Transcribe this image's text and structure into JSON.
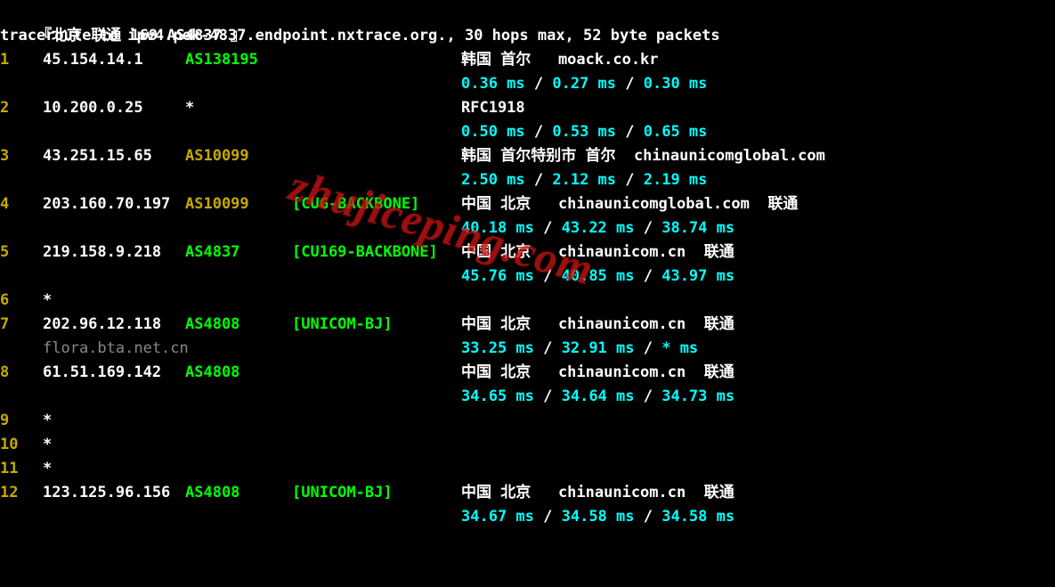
{
  "header": {
    "prefix": "『北京 联通 ",
    "asn_text": "169 AS4837",
    "suffix": " 』"
  },
  "trace_line": "traceroute to ipv4.pek-4837.endpoint.nxtrace.org., 30 hops max, 52 byte packets",
  "watermark": "zhujiceping.com",
  "hops": [
    {
      "n": "1",
      "ip": "45.154.14.1",
      "asn": "AS138195",
      "asn_color": "green",
      "net": "",
      "loc": "韩国 首尔   moack.co.kr",
      "lat": [
        "0.36 ms",
        "0.27 ms",
        "0.30 ms"
      ],
      "rdns": ""
    },
    {
      "n": "2",
      "ip": "10.200.0.25",
      "asn": "*",
      "asn_color": "white",
      "net": "",
      "loc": "RFC1918",
      "lat": [
        "0.50 ms",
        "0.53 ms",
        "0.65 ms"
      ],
      "rdns": ""
    },
    {
      "n": "3",
      "ip": "43.251.15.65",
      "asn": "AS10099",
      "asn_color": "yellow",
      "net": "",
      "loc": "韩国 首尔特别市 首尔  chinaunicomglobal.com",
      "lat": [
        "2.50 ms",
        "2.12 ms",
        "2.19 ms"
      ],
      "rdns": ""
    },
    {
      "n": "4",
      "ip": "203.160.70.197",
      "asn": "AS10099",
      "asn_color": "yellow",
      "net": "[CUG-BACKBONE]",
      "loc": "中国 北京   chinaunicomglobal.com  联通",
      "lat": [
        "40.18 ms",
        "43.22 ms",
        "38.74 ms"
      ],
      "rdns": ""
    },
    {
      "n": "5",
      "ip": "219.158.9.218",
      "asn": "AS4837",
      "asn_color": "green",
      "net": "[CU169-BACKBONE]",
      "loc": "中国 北京   chinaunicom.cn  联通",
      "lat": [
        "45.76 ms",
        "40.85 ms",
        "43.97 ms"
      ],
      "rdns": ""
    },
    {
      "n": "6",
      "ip": "*",
      "asn": "",
      "asn_color": "white",
      "net": "",
      "loc": "",
      "lat": [],
      "rdns": ""
    },
    {
      "n": "7",
      "ip": "202.96.12.118",
      "asn": "AS4808",
      "asn_color": "green",
      "net": "[UNICOM-BJ]",
      "loc": "中国 北京   chinaunicom.cn  联通",
      "lat": [
        "33.25 ms",
        "32.91 ms",
        "* ms"
      ],
      "rdns": "flora.bta.net.cn"
    },
    {
      "n": "8",
      "ip": "61.51.169.142",
      "asn": "AS4808",
      "asn_color": "green",
      "net": "",
      "loc": "中国 北京   chinaunicom.cn  联通",
      "lat": [
        "34.65 ms",
        "34.64 ms",
        "34.73 ms"
      ],
      "rdns": ""
    },
    {
      "n": "9",
      "ip": "*",
      "asn": "",
      "asn_color": "white",
      "net": "",
      "loc": "",
      "lat": [],
      "rdns": ""
    },
    {
      "n": "10",
      "ip": "*",
      "asn": "",
      "asn_color": "white",
      "net": "",
      "loc": "",
      "lat": [],
      "rdns": ""
    },
    {
      "n": "11",
      "ip": "*",
      "asn": "",
      "asn_color": "white",
      "net": "",
      "loc": "",
      "lat": [],
      "rdns": ""
    },
    {
      "n": "12",
      "ip": "123.125.96.156",
      "asn": "AS4808",
      "asn_color": "green",
      "net": "[UNICOM-BJ]",
      "loc": "中国 北京   chinaunicom.cn  联通",
      "lat": [
        "34.67 ms",
        "34.58 ms",
        "34.58 ms"
      ],
      "rdns": ""
    }
  ]
}
